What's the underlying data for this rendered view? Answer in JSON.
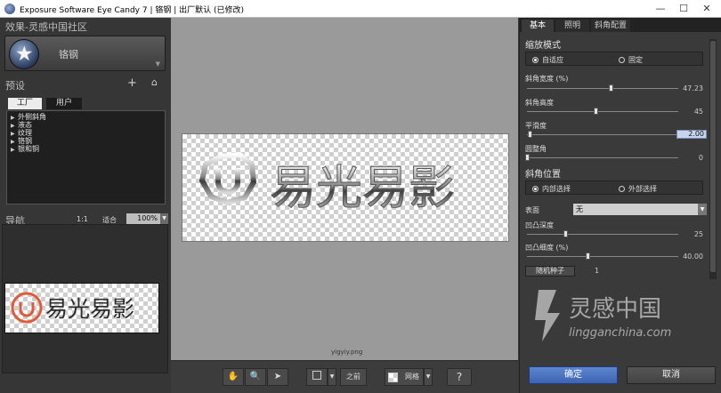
{
  "window": {
    "title": "Exposure Software Eye Candy 7 | 铬钢 | 出厂默认 (已修改)"
  },
  "left_panel": {
    "effects_header": "效果-灵感中国社区",
    "effect_name": "铬钢",
    "presets_header": "预设",
    "preset_tabs": [
      "工厂",
      "用户"
    ],
    "preset_items": [
      "外侧斜角",
      "液态",
      "纹理",
      "铬钢",
      "银和铜"
    ],
    "nav_header": "导航",
    "zoom_ratio": "1:1",
    "fit_label": "适合",
    "zoom_value": "100%",
    "thumb_text": "易光易影"
  },
  "center": {
    "canvas_text": "易光易影",
    "file_label": "yigyiy.png",
    "toolbar": {
      "before_label": "之前",
      "grid_label": "网格",
      "help_label": "?"
    }
  },
  "right_panel": {
    "tabs": [
      "基本",
      "照明",
      "斜角配置"
    ],
    "scale_mode_title": "缩放模式",
    "scale_modes": [
      "自适应",
      "固定"
    ],
    "scale_mode_selected": 0,
    "params": [
      {
        "label": "斜角宽度 (%)",
        "value": "47.23",
        "level": 0.55
      },
      {
        "label": "斜角高度",
        "value": "45",
        "level": 0.45
      },
      {
        "label": "平滑度",
        "value": "2.00",
        "level": 0.02
      },
      {
        "label": "圆整角",
        "value": "0",
        "level": 0.0
      }
    ],
    "bevel_position_title": "斜角位置",
    "bevel_positions": [
      "内部选择",
      "外部选择"
    ],
    "bevel_position_selected": 0,
    "surface_label": "表面",
    "surface_value": "无",
    "surface_params": [
      {
        "label": "凹凸深度",
        "value": "25",
        "level": 0.25
      },
      {
        "label": "凹凸细度 (%)",
        "value": "40.00",
        "level": 0.4
      }
    ],
    "random_seed_label": "随机种子",
    "random_seed_value": "1",
    "ok_label": "确定",
    "cancel_label": "取消"
  },
  "watermark": {
    "brand": "灵感中国",
    "url": "lingganchina.com"
  },
  "colors": {
    "accent_blue": "#3d64b2",
    "logo_red": "#e05a3a"
  }
}
